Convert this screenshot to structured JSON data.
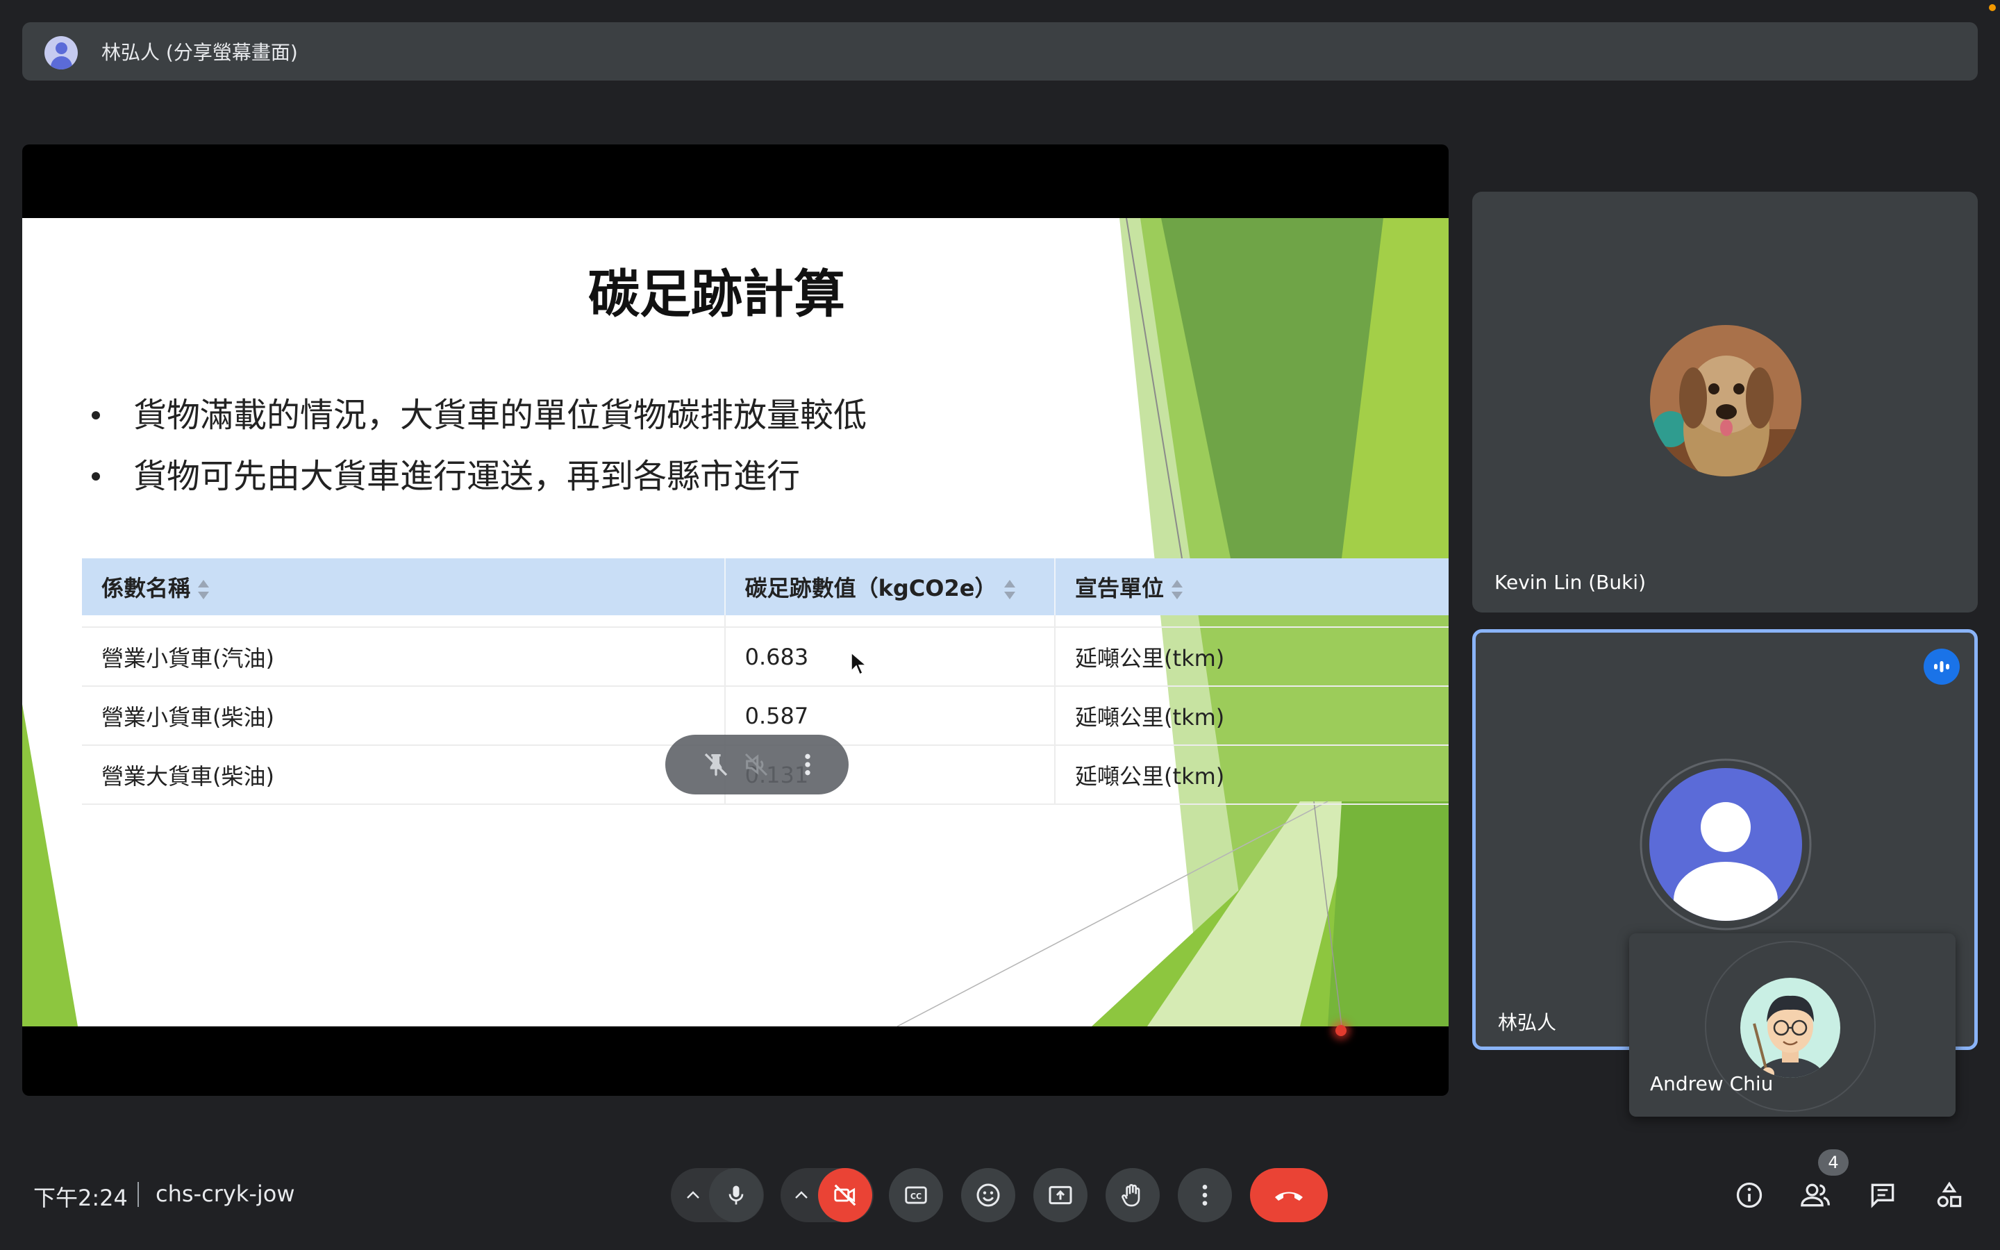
{
  "presenter_bar": {
    "title": "林弘人 (分享螢幕畫面)"
  },
  "slide": {
    "title": "碳足跡計算",
    "bullets": [
      "貨物滿載的情況，大貨車的單位貨物碳排放量較低",
      "貨物可先由大貨車進行運送，再到各縣市進行"
    ],
    "table": {
      "headers": [
        "係數名稱",
        "碳足跡數值（kgCO2e）",
        "宣告單位"
      ],
      "rows": [
        [
          "營業小貨車(汽油)",
          "0.683",
          "延噸公里(tkm)"
        ],
        [
          "營業小貨車(柴油)",
          "0.587",
          "延噸公里(tkm)"
        ],
        [
          "營業大貨車(柴油)",
          "0.131",
          "延噸公里(tkm)"
        ]
      ]
    }
  },
  "participants": [
    {
      "name": "Kevin Lin (Buki)"
    },
    {
      "name": "林弘人",
      "speaking": true
    },
    {
      "name": "Andrew Chiu"
    }
  ],
  "bottom_bar": {
    "time": "下午2:24",
    "meeting_code": "chs-cryk-jow",
    "people_count": "4"
  },
  "colors": {
    "background": "#202124",
    "tile": "#3c4043",
    "accent_blue": "#8ab4f8",
    "end_call": "#ea4335",
    "slide_green": "#8dc63f"
  }
}
